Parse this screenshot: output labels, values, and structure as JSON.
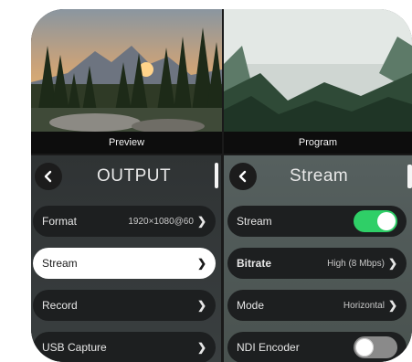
{
  "preview": {
    "label": "Preview"
  },
  "program": {
    "label": "Program"
  },
  "output_menu": {
    "title": "OUTPUT",
    "items": [
      {
        "label": "Format",
        "value": "1920×1080@60"
      },
      {
        "label": "Stream",
        "value": ""
      },
      {
        "label": "Record",
        "value": ""
      },
      {
        "label": "USB Capture",
        "value": ""
      }
    ],
    "selected": "Stream"
  },
  "stream_menu": {
    "title": "Stream",
    "items": [
      {
        "label": "Stream",
        "toggle": "on"
      },
      {
        "label": "Bitrate",
        "value": "High  (8 Mbps)"
      },
      {
        "label": "Mode",
        "value": "Horizontal"
      },
      {
        "label": "NDI Encoder",
        "toggle": "off"
      }
    ]
  },
  "colors": {
    "toggle_on": "#2fcf67",
    "row_bg": "#1d1f20",
    "selected_bg": "#ffffff"
  }
}
